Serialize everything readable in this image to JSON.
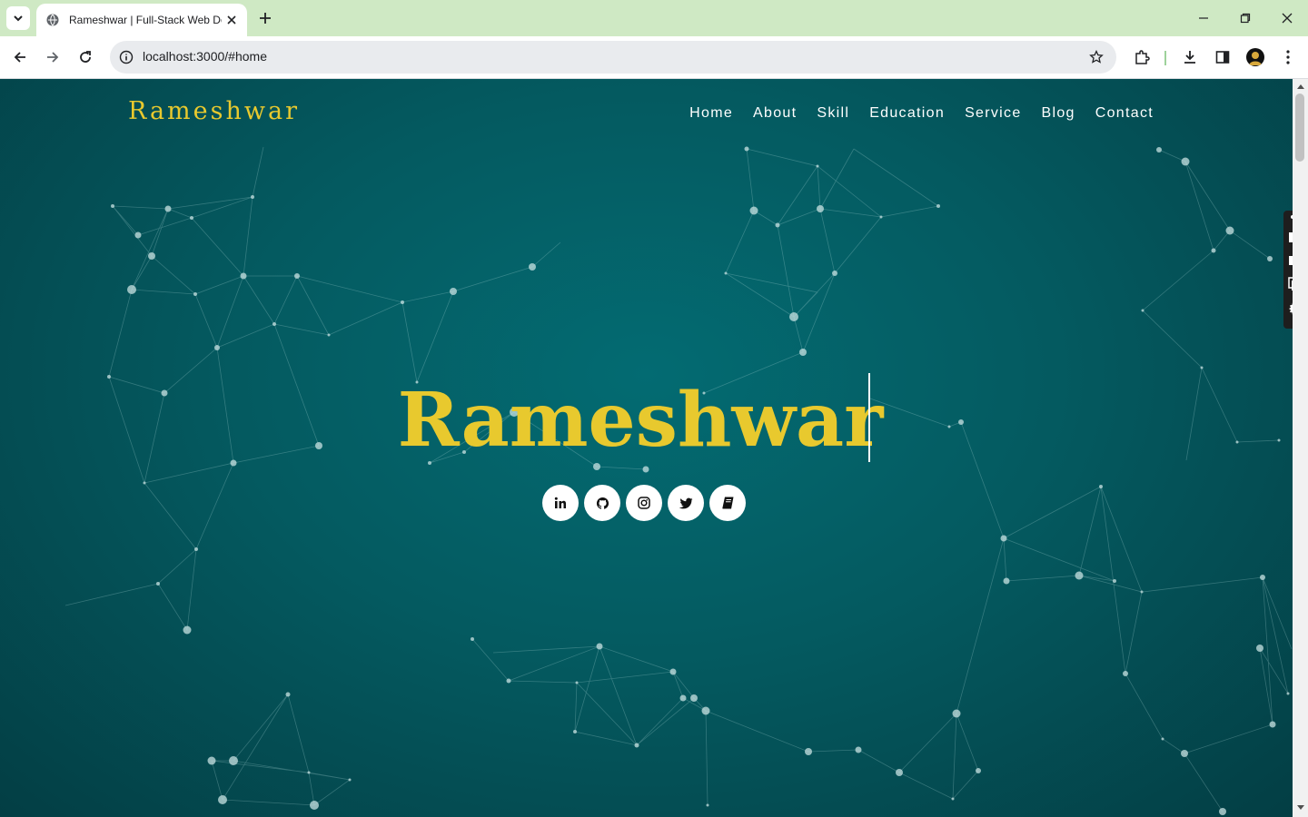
{
  "browser": {
    "tab_title": "Rameshwar | Full-Stack Web De",
    "url": "localhost:3000/#home",
    "accent_color": "#cfe9c4"
  },
  "site": {
    "brand": "Rameshwar",
    "nav": [
      "Home",
      "About",
      "Skill",
      "Education",
      "Service",
      "Blog",
      "Contact"
    ],
    "hero_title": "Rameshwar",
    "socials": [
      "linkedin-icon",
      "github-icon",
      "instagram-icon",
      "twitter-icon",
      "book-icon"
    ],
    "colors": {
      "brand": "#e8c92e",
      "background": "#045a60",
      "text": "#ffffff"
    }
  }
}
